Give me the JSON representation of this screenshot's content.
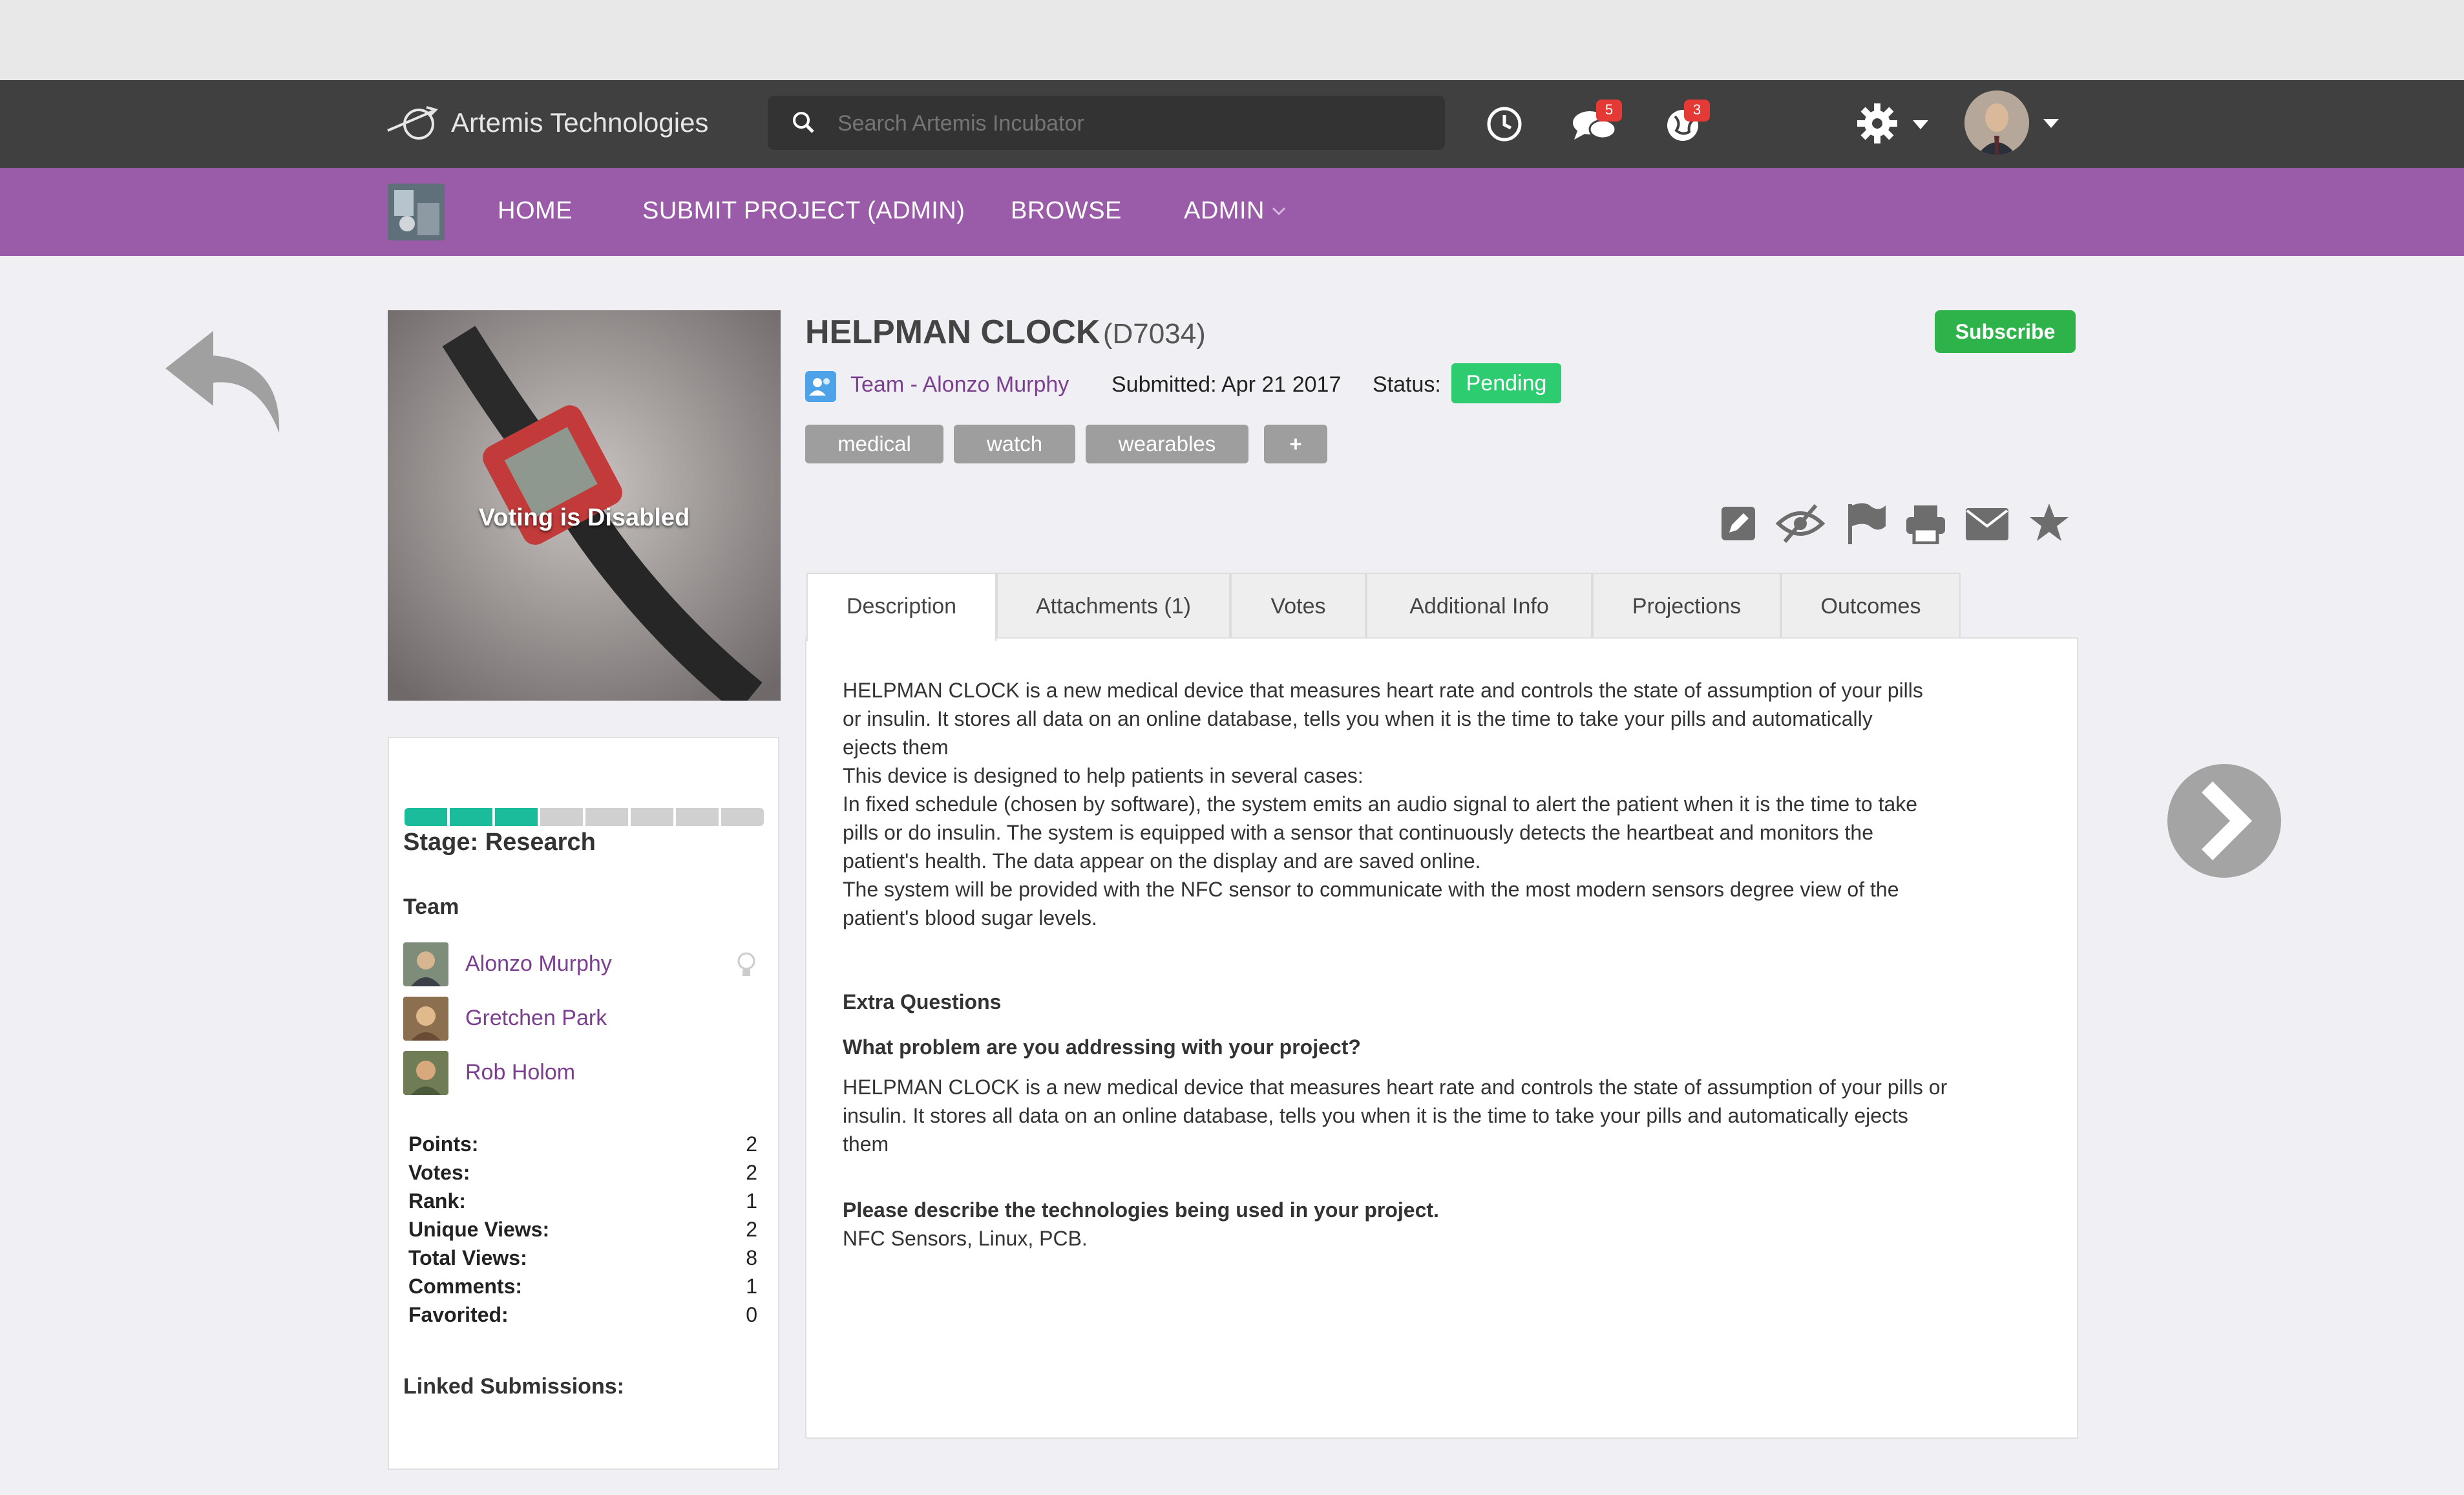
{
  "header": {
    "logo_text": "Artemis Technologies",
    "search_placeholder": "Search Artemis Incubator",
    "messages_badge": "5",
    "notifications_badge": "3"
  },
  "nav": {
    "home": "HOME",
    "submit": "SUBMIT PROJECT (ADMIN)",
    "browse": "BROWSE",
    "admin": "ADMIN"
  },
  "project": {
    "title": "HELPMAN CLOCK",
    "code": "(D7034)",
    "team_link": "Team - Alonzo Murphy",
    "submitted": "Submitted: Apr 21 2017",
    "status_label": "Status:",
    "status_value": "Pending",
    "subscribe_label": "Subscribe",
    "tags": [
      "medical",
      "watch",
      "wearables"
    ],
    "add_tag_label": "+",
    "voting_overlay": "Voting is Disabled"
  },
  "sidebar": {
    "progress_segments_filled": 3,
    "progress_segments_total": 8,
    "stage": "Stage: Research",
    "team_heading": "Team",
    "members": [
      "Alonzo Murphy",
      "Gretchen Park",
      "Rob Holom"
    ],
    "stats": [
      {
        "label": "Points:",
        "value": "2"
      },
      {
        "label": "Votes:",
        "value": "2"
      },
      {
        "label": "Rank:",
        "value": "1"
      },
      {
        "label": "Unique Views:",
        "value": "2"
      },
      {
        "label": "Total Views:",
        "value": "8"
      },
      {
        "label": "Comments:",
        "value": "1"
      },
      {
        "label": "Favorited:",
        "value": "0"
      }
    ],
    "linked_heading": "Linked Submissions:"
  },
  "tabs": [
    "Description",
    "Attachments (1)",
    "Votes",
    "Additional Info",
    "Projections",
    "Outcomes"
  ],
  "description": {
    "lines": [
      "HELPMAN CLOCK is a new medical device that measures heart rate and controls the state of assumption of your pills",
      "or insulin. It stores all data on an online database, tells you when it is the time to take your pills and automatically",
      "ejects them",
      "This device is designed to help patients in several cases:",
      "In fixed schedule (chosen by software), the system emits an audio signal to alert the patient when it is the time to take",
      "pills or do insulin. The system is equipped with a sensor that continuously detects the heartbeat and monitors the",
      "patient's health. The data appear on the display and are saved online.",
      "The system will be provided with the NFC sensor to communicate with the most modern sensors degree view of the",
      "patient's blood sugar levels."
    ],
    "extra_heading": "Extra Questions",
    "q1": "What problem are you addressing with your project?",
    "a1_lines": [
      "HELPMAN CLOCK is a new medical device that measures heart rate and controls the state of assumption of your pills or",
      "insulin. It stores all data on an online database, tells you when it is the time to take your pills and automatically ejects",
      "them"
    ],
    "q2": "Please describe the technologies being used in your project.",
    "a2": "NFC Sensors, Linux, PCB."
  }
}
